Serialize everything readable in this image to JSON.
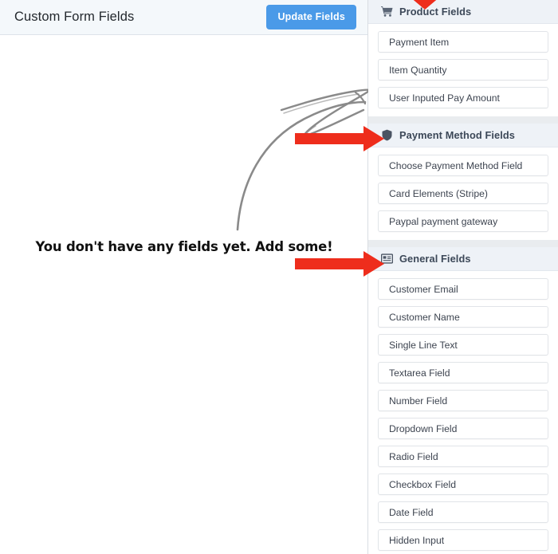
{
  "editor": {
    "title": "Custom Form Fields",
    "update_button": "Update Fields",
    "empty_message": "You don't have any fields yet. Add some!"
  },
  "colors": {
    "accent_button": "#4a9ae8",
    "annotation_arrow": "#ee2d1c",
    "doodle": "#888888",
    "group_header_bg": "#eef2f7",
    "page_bg": "#e9ecef"
  },
  "sidebar": {
    "groups": [
      {
        "title": "Product Fields",
        "icon": "shopping-cart-icon",
        "items": [
          {
            "label": "Payment Item"
          },
          {
            "label": "Item Quantity"
          },
          {
            "label": "User Inputed Pay Amount"
          }
        ]
      },
      {
        "title": "Payment Method Fields",
        "icon": "shield-icon",
        "items": [
          {
            "label": "Choose Payment Method Field"
          },
          {
            "label": "Card Elements (Stripe)"
          },
          {
            "label": "Paypal payment gateway"
          }
        ]
      },
      {
        "title": "General Fields",
        "icon": "form-list-icon",
        "items": [
          {
            "label": "Customer Email"
          },
          {
            "label": "Customer Name"
          },
          {
            "label": "Single Line Text"
          },
          {
            "label": "Textarea Field"
          },
          {
            "label": "Number Field"
          },
          {
            "label": "Dropdown Field"
          },
          {
            "label": "Radio Field"
          },
          {
            "label": "Checkbox Field"
          },
          {
            "label": "Date Field"
          },
          {
            "label": "Hidden Input"
          }
        ]
      }
    ]
  },
  "annotations": [
    {
      "name": "arrow-to-product-fields",
      "type": "red-arrow-down"
    },
    {
      "name": "arrow-to-payment-method-fields",
      "type": "red-arrow-right"
    },
    {
      "name": "arrow-to-general-fields",
      "type": "red-arrow-right"
    },
    {
      "name": "hand-drawn-curved-arrow",
      "type": "gray-doodle-arrow"
    }
  ]
}
